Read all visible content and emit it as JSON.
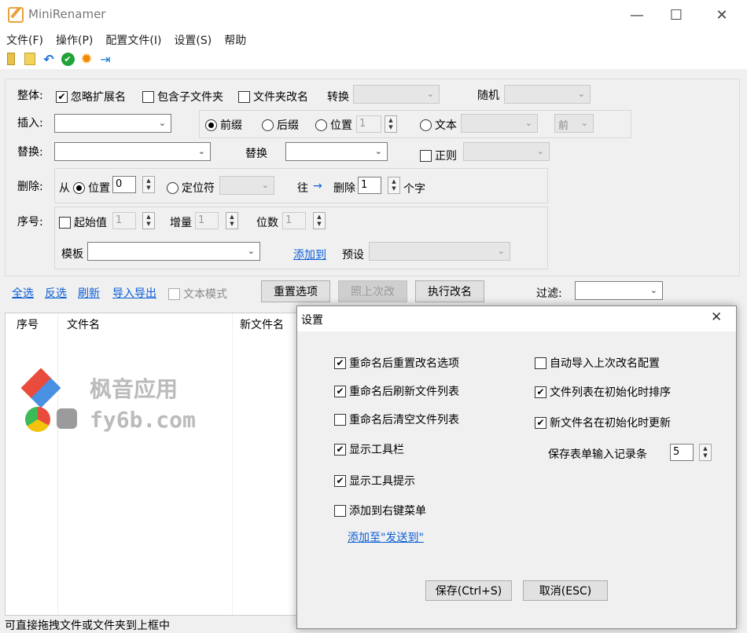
{
  "window": {
    "title": "MiniRenamer",
    "minimize": "—",
    "maximize": "☐",
    "close": "✕"
  },
  "menu": [
    "文件(F)",
    "操作(P)",
    "配置文件(I)",
    "设置(S)",
    "帮助"
  ],
  "toolbar": {
    "icons": [
      "folder-icon",
      "files-icon",
      "undo-icon",
      "check-icon",
      "gear-icon",
      "pin-icon"
    ]
  },
  "overall": {
    "label": "整体:",
    "ignore_ext": "忽略扩展名",
    "include_sub": "包含子文件夹",
    "rename_folder": "文件夹改名",
    "convert": "转换",
    "random": "随机"
  },
  "insert": {
    "label": "插入:",
    "prefix": "前缀",
    "suffix": "后缀",
    "position": "位置",
    "position_value": "1",
    "text": "文本",
    "dir": "前"
  },
  "replace": {
    "label": "替换:",
    "with": "替换",
    "regex": "正则"
  },
  "delete": {
    "label": "删除:",
    "from": "从",
    "position": "位置",
    "position_value": "0",
    "locator": "定位符",
    "toward": "往",
    "arrow": "→",
    "delete": "删除",
    "count": "1",
    "unit": "个字"
  },
  "sequence": {
    "label": "序号:",
    "start": "起始值",
    "start_value": "1",
    "step": "增量",
    "step_value": "1",
    "digits": "位数",
    "digits_value": "1",
    "template": "模板",
    "add_to": "添加到",
    "preset": "预设"
  },
  "actions": {
    "select_all": "全选",
    "invert": "反选",
    "refresh": "刷新",
    "import_export": "导入导出",
    "text_mode": "文本模式",
    "reset": "重置选项",
    "last": "照上次改",
    "execute": "执行改名",
    "filter": "过滤:"
  },
  "list": {
    "headers": [
      "序号",
      "文件名",
      "新文件名"
    ]
  },
  "status": "可直接拖拽文件或文件夹到上框中",
  "watermark": {
    "cn": "枫音应用",
    "en": "fy6b.com"
  },
  "dialog": {
    "title": "设置",
    "close": "✕",
    "left_options": [
      {
        "label": "重命名后重置改名选项",
        "checked": true
      },
      {
        "label": "重命名后刷新文件列表",
        "checked": true
      },
      {
        "label": "重命名后清空文件列表",
        "checked": false
      },
      {
        "label": "显示工具栏",
        "checked": true
      },
      {
        "label": "显示工具提示",
        "checked": true
      },
      {
        "label": "添加到右键菜单",
        "checked": false
      }
    ],
    "right_options": [
      {
        "label": "自动导入上次改名配置",
        "checked": false
      },
      {
        "label": "文件列表在初始化时排序",
        "checked": true
      },
      {
        "label": "新文件名在初始化时更新",
        "checked": true
      }
    ],
    "history_label": "保存表单输入记录条",
    "history_value": "5",
    "sendto_link": "添加至\"发送到\"",
    "save": "保存(Ctrl+S)",
    "cancel": "取消(ESC)"
  }
}
